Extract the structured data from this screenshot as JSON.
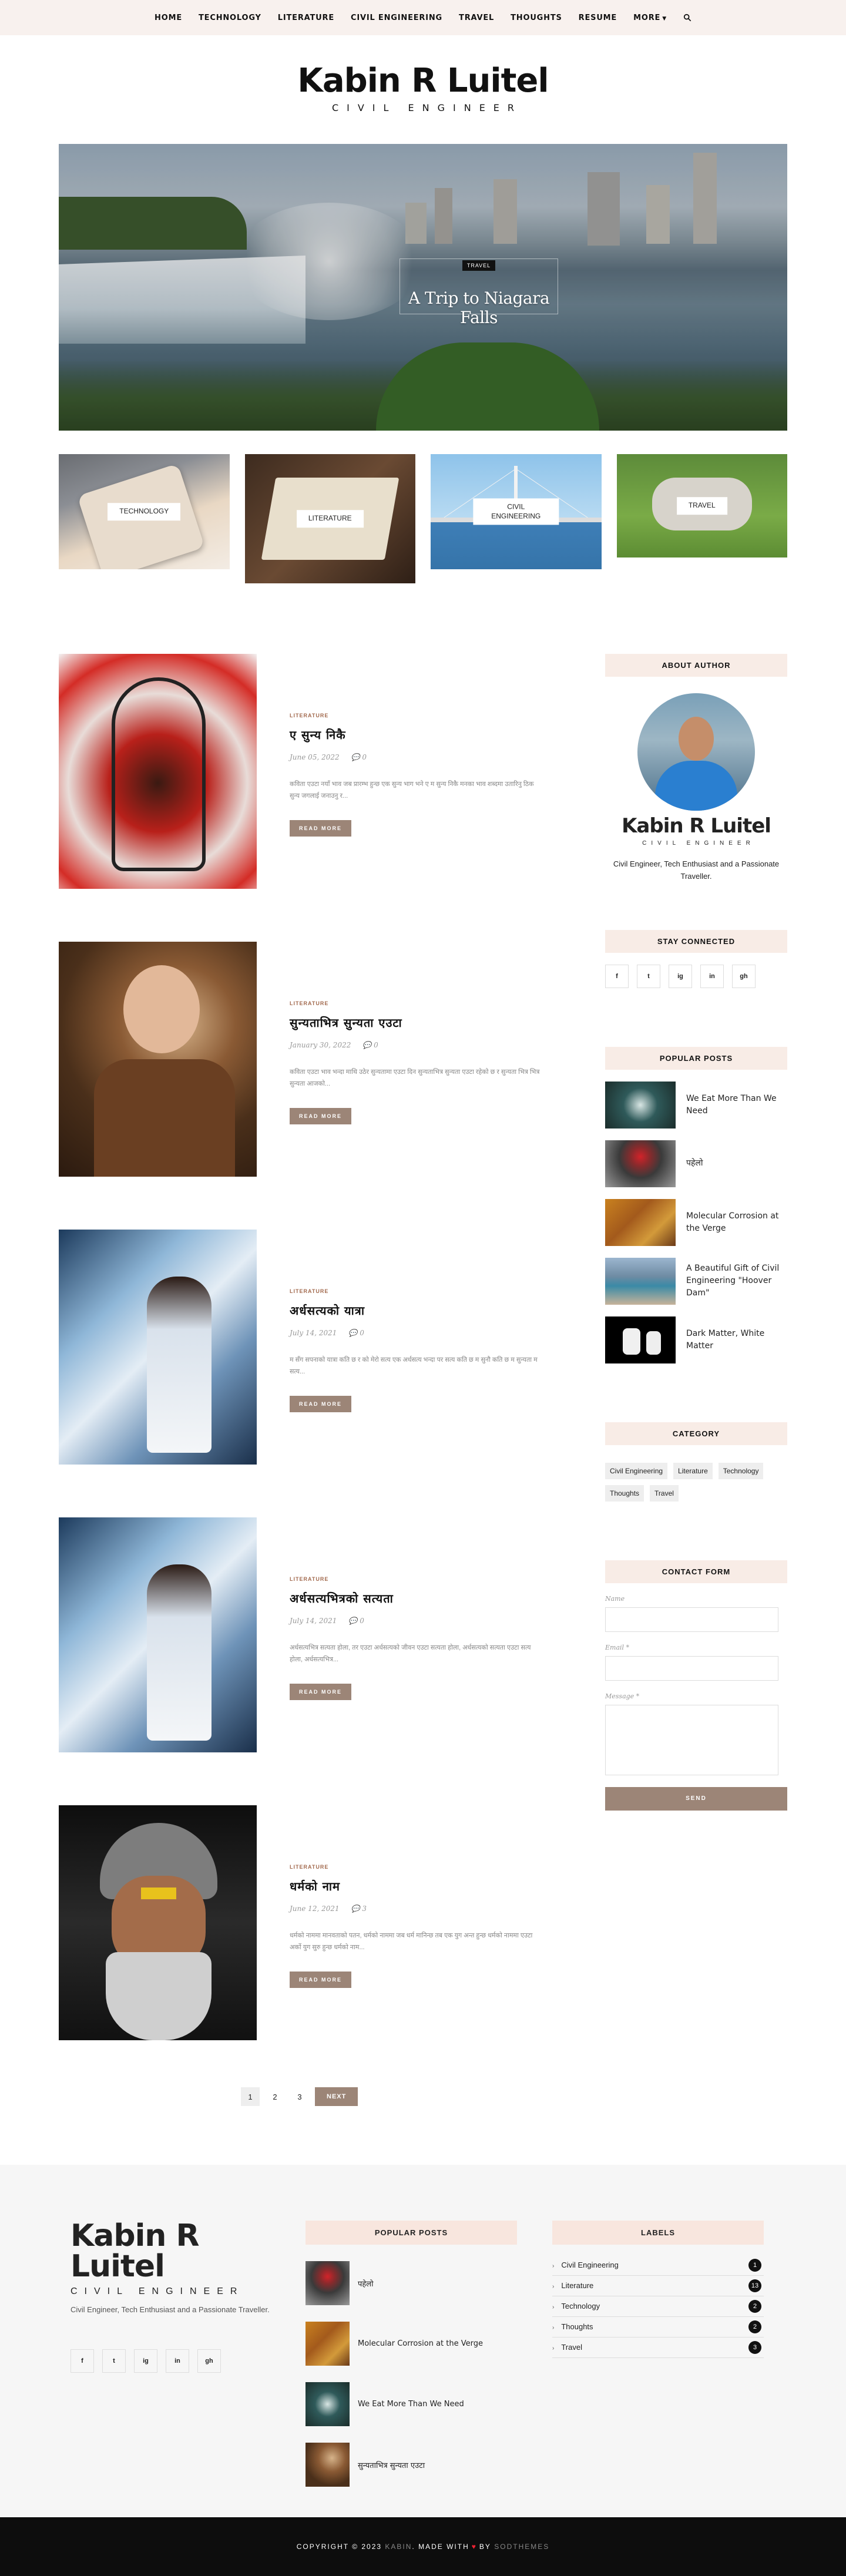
{
  "nav": {
    "items": [
      "HOME",
      "TECHNOLOGY",
      "LITERATURE",
      "CIVIL ENGINEERING",
      "TRAVEL",
      "THOUGHTS",
      "RESUME",
      "MORE"
    ]
  },
  "brand": {
    "title": "Kabin R Luitel",
    "subtitle": "CIVIL ENGINEER"
  },
  "hero": {
    "tag": "TRAVEL",
    "title": "A Trip to Niagara Falls"
  },
  "categories": [
    {
      "label": "TECHNOLOGY"
    },
    {
      "label": "LITERATURE"
    },
    {
      "label": "CIVIL ENGINEERING"
    },
    {
      "label": "TRAVEL"
    }
  ],
  "posts": [
    {
      "category": "LITERATURE",
      "title": "ए सुन्य निकै",
      "date": "June 05, 2022",
      "comments": "0",
      "excerpt": "कविता एउटा नयाँ भाव जब प्रारम्भ हुन्छ एक सुन्य भाग भने ए म सुन्य निकै मनका भाव शब्दमा उतारिनु ठिक सुन्य जगलाई जनाउनु र...",
      "read_more": "READ MORE"
    },
    {
      "category": "LITERATURE",
      "title": "सुन्यताभित्र सुन्यता एउटा",
      "date": "January 30, 2022",
      "comments": "0",
      "excerpt": "कविता एउटा भाव भन्दा माथि उठेर सुन्यतामा एउटा दिन सुन्यताभित्र सुन्यता एउटा रहेको छ र सुन्यता भित्र भित्र सुन्यता आजको...",
      "read_more": "READ MORE"
    },
    {
      "category": "LITERATURE",
      "title": "अर्धसत्यको यात्रा",
      "date": "July 14, 2021",
      "comments": "0",
      "excerpt": "म सँग सपनाको यात्रा कति छ र को मेरो सत्य एक अर्धसत्य भन्दा पर सत्य कति छ म सुनौ कति छ म सुन्यता म सत्य...",
      "read_more": "READ MORE"
    },
    {
      "category": "LITERATURE",
      "title": "अर्धसत्यभित्रको सत्यता",
      "date": "July 14, 2021",
      "comments": "0",
      "excerpt": "अर्धसत्यभित्र सत्यता होला, तर एउटा अर्धसत्यको जीवन एउटा सत्यता होला, अर्धसत्यको सत्यता एउटा सत्य होला, अर्धसत्यभित्र...",
      "read_more": "READ MORE"
    },
    {
      "category": "LITERATURE",
      "title": "धर्मको नाम",
      "date": "June 12, 2021",
      "comments": "3",
      "excerpt": "धर्मको नाममा मानवताको पतन, धर्मको नाममा जब धर्म मानिन्छ तब एक युग अन्त हुन्छ धर्मको नाममा एउटा अर्को युग सुरु हुन्छ धर्मको नाम...",
      "read_more": "READ MORE"
    }
  ],
  "pagination": {
    "pages": [
      "1",
      "2",
      "3"
    ],
    "next": "NEXT"
  },
  "sidebar": {
    "about_title": "ABOUT AUTHOR",
    "author_brand": "Kabin R Luitel",
    "author_sub": "CIVIL ENGINEER",
    "bio": "Civil Engineer, Tech Enthusiast and a Passionate Traveller.",
    "stay_title": "STAY CONNECTED",
    "social": [
      "f",
      "t",
      "ig",
      "in",
      "gh"
    ],
    "popular_title": "POPULAR POSTS",
    "popular": [
      {
        "title": "We Eat More Than We Need"
      },
      {
        "title": "पहेलो"
      },
      {
        "title": "Molecular Corrosion at the Verge"
      },
      {
        "title": "A Beautiful Gift of Civil Engineering \"Hoover Dam\""
      },
      {
        "title": "Dark Matter, White Matter"
      }
    ],
    "category_title": "CATEGORY",
    "tags": [
      "Civil Engineering",
      "Literature",
      "Technology",
      "Thoughts",
      "Travel"
    ],
    "contact_title": "CONTACT FORM",
    "form": {
      "name": "Name",
      "email": "Email *",
      "message": "Message *",
      "send": "SEND"
    }
  },
  "footer": {
    "brand": "Kabin R Luitel",
    "sub": "CIVIL ENGINEER",
    "desc": "Civil Engineer, Tech Enthusiast and a Passionate Traveller.",
    "popular_title": "POPULAR POSTS",
    "popular": [
      {
        "title": "पहेलो"
      },
      {
        "title": "Molecular Corrosion at the Verge"
      },
      {
        "title": "We Eat More Than We Need"
      },
      {
        "title": "सुन्यताभित्र सुन्यता एउटा"
      }
    ],
    "labels_title": "LABELS",
    "labels": [
      {
        "name": "Civil Engineering",
        "count": "1"
      },
      {
        "name": "Literature",
        "count": "13"
      },
      {
        "name": "Technology",
        "count": "2"
      },
      {
        "name": "Thoughts",
        "count": "2"
      },
      {
        "name": "Travel",
        "count": "3"
      }
    ],
    "copyright_a": "COPYRIGHT © 2023",
    "copyright_b": "KABIN",
    "copyright_c": ". MADE WITH",
    "copyright_d": "BY",
    "copyright_e": "SODTHEMES",
    "heart": "♥"
  },
  "colors": {
    "accent": "#9c8577",
    "widget_bg": "#f8ece6",
    "nav_bg": "#f8f1ee"
  }
}
